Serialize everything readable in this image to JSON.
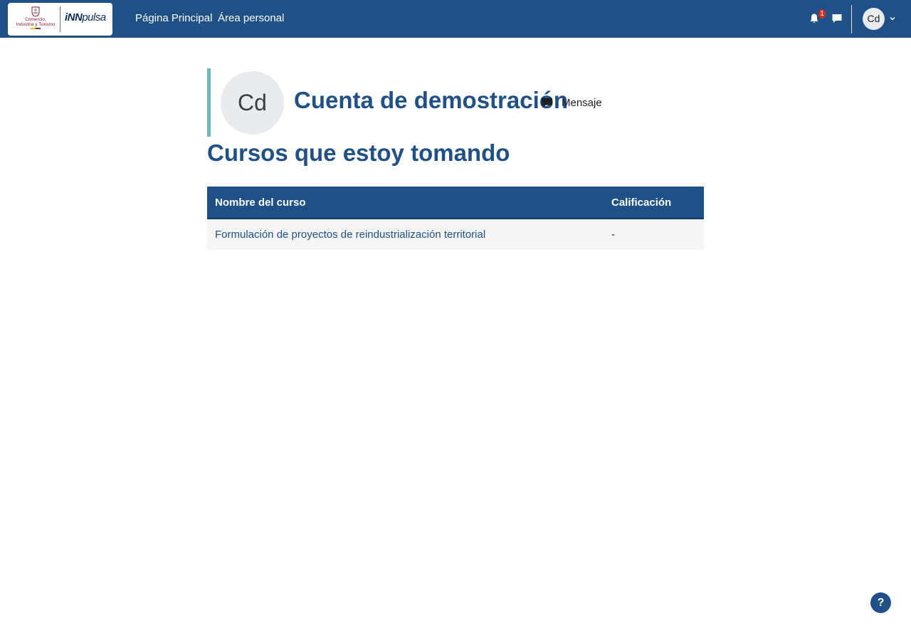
{
  "colors": {
    "brand": "#1f5188",
    "accent": "#6fb9b9",
    "badge": "#ca3120"
  },
  "navbar": {
    "logo": {
      "left_text_1": "Comercio,",
      "left_text_2": "Industria y Turismo",
      "right_text_inn": "iNN",
      "right_text_pulsa": "pulsa"
    },
    "links": [
      {
        "label": "Página Principal"
      },
      {
        "label": "Área personal"
      }
    ],
    "notifications": {
      "icon": "bell-icon",
      "count": "1"
    },
    "messages": {
      "icon": "chat-icon"
    },
    "user": {
      "initials": "Cd"
    }
  },
  "profile": {
    "initials": "Cd",
    "name": "Cuenta de demostración",
    "message_button": {
      "icon": "chat-icon",
      "label": "Mensaje"
    }
  },
  "courses": {
    "title": "Cursos que estoy tomando",
    "columns": [
      "Nombre del curso",
      "Calificación"
    ],
    "rows": [
      {
        "name": "Formulación de proyectos de reindustrialización territorial",
        "grade": "-"
      }
    ]
  },
  "help": {
    "label": "?"
  }
}
